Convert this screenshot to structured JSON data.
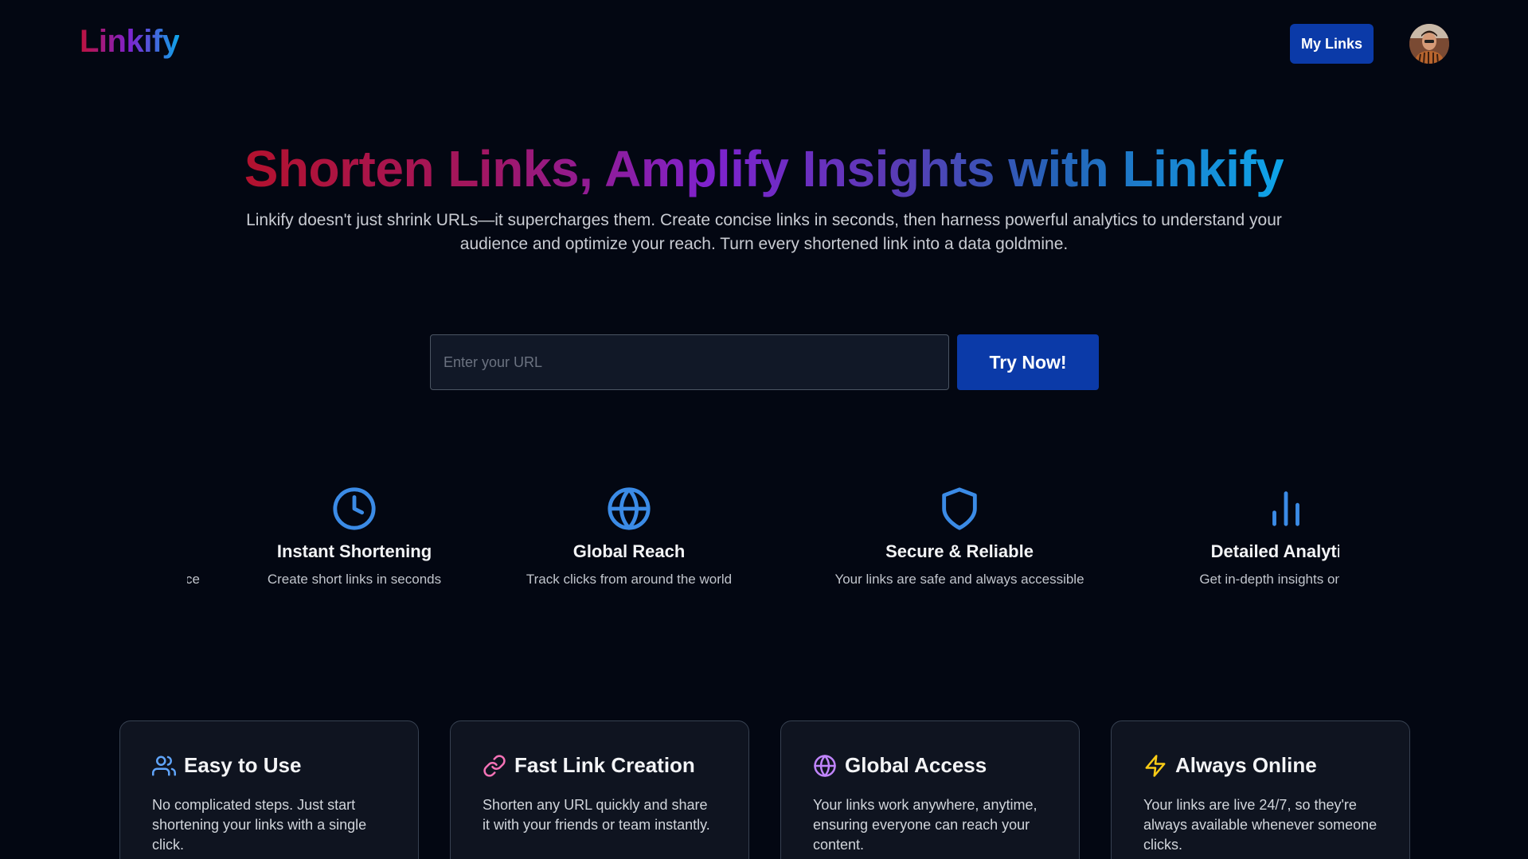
{
  "header": {
    "logo": "Linkify",
    "my_links_label": "My Links",
    "avatar_icon": "user-avatar"
  },
  "hero": {
    "title": "Shorten Links, Amplify Insights with Linkify",
    "subtitle": "Linkify doesn't just shrink URLs—it supercharges them. Create concise links in seconds, then harness powerful analytics to understand your audience and optimize your reach. Turn every shortened link into a data goldmine."
  },
  "search": {
    "placeholder": "Enter your URL",
    "value": "",
    "button_label": "Try Now!"
  },
  "features": {
    "partial_left_desc": "ce",
    "items": [
      {
        "icon": "clock-icon",
        "title": "Instant Shortening",
        "desc": "Create short links in seconds"
      },
      {
        "icon": "globe-icon",
        "title": "Global Reach",
        "desc": "Track clicks from around the world"
      },
      {
        "icon": "shield-icon",
        "title": "Secure & Reliable",
        "desc": "Your links are safe and always accessible"
      },
      {
        "icon": "bar-chart-icon",
        "title": "Detailed Analytics",
        "desc": "Get in-depth insights on your"
      }
    ]
  },
  "cards": [
    {
      "icon": "users-icon",
      "icon_color": "#60a5fa",
      "title": "Easy to Use",
      "text": "No complicated steps. Just start shortening your links with a single click."
    },
    {
      "icon": "link-icon",
      "icon_color": "#f472b6",
      "title": "Fast Link Creation",
      "text": "Shorten any URL quickly and share it with your friends or team instantly."
    },
    {
      "icon": "globe-icon",
      "icon_color": "#c084fc",
      "title": "Global Access",
      "text": "Your links work anywhere, anytime, ensuring everyone can reach your content."
    },
    {
      "icon": "zap-icon",
      "icon_color": "#facc15",
      "title": "Always Online",
      "text": "Your links are live 24/7, so they're always available whenever someone clicks."
    }
  ],
  "colors": {
    "background": "#030712",
    "primary_button": "#0b3aa8",
    "feature_icon": "#3b8be6"
  }
}
